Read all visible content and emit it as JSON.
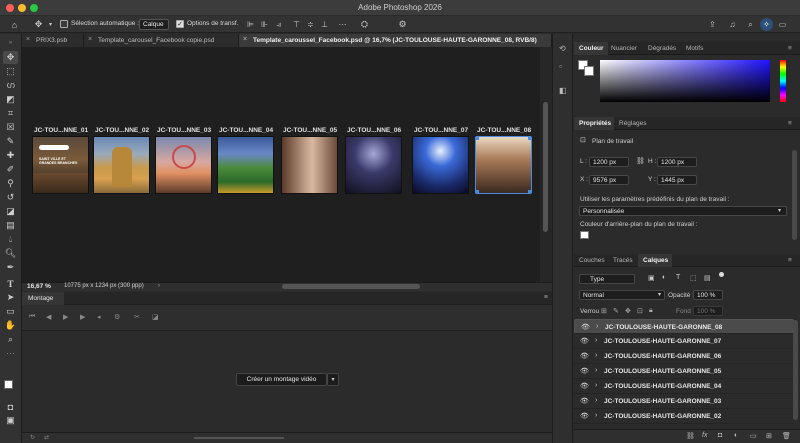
{
  "app": {
    "title": "Adobe Photoshop 2026"
  },
  "options_bar": {
    "auto_select_label": "Sélection automatique :",
    "auto_select_value": "Calque",
    "transform_options_label": "Options de transf."
  },
  "tabs": [
    {
      "label": "PRIX3.psb"
    },
    {
      "label": "Template_carousel_Facebook copie.psd"
    },
    {
      "label": "Template_caroussel_Facebook.psd @ 16,7% (JC-TOULOUSE-HAUTE-GARONNE_08, RVB/8)"
    }
  ],
  "artboards": [
    {
      "label": "JC-TOU...NNE_01",
      "overlay": "SAINT VILLE ET\nGRANDES BRANCHES"
    },
    {
      "label": "JC-TOU...NNE_02"
    },
    {
      "label": "JC-TOU...NNE_03"
    },
    {
      "label": "JC-TOU...NNE_04"
    },
    {
      "label": "JC-TOU...NNE_05"
    },
    {
      "label": "JC-TOU...NNE_06"
    },
    {
      "label": "JC-TOU...NNE_07"
    },
    {
      "label": "JC-TOU...NNE_08"
    }
  ],
  "status": {
    "zoom": "16,67 %",
    "doc_size": "10775 px x 1234 px (300 ppp)"
  },
  "montage": {
    "tab": "Montage",
    "create_button": "Créer un montage vidéo"
  },
  "color_panel": {
    "tabs": [
      "Couleur",
      "Nuancier",
      "Dégradés",
      "Motifs"
    ]
  },
  "properties_panel": {
    "tabs": [
      "Propriétés",
      "Réglages"
    ],
    "section": "Plan de travail",
    "w_label": "L :",
    "w_value": "1200 px",
    "h_label": "H :",
    "h_value": "1200 px",
    "x_label": "X :",
    "x_value": "9576 px",
    "y_label": "Y :",
    "y_value": "1445 px",
    "preset_label": "Utiliser les paramètres prédéfinis du plan de travail :",
    "preset_value": "Personnalisée",
    "bg_label": "Couleur d'arrière-plan du plan de travail :"
  },
  "layers_panel": {
    "tabs": [
      "Couches",
      "Tracés",
      "Calques"
    ],
    "filter_value": "Type",
    "blend_mode": "Normal",
    "opacity_label": "Opacité :",
    "opacity_value": "100 %",
    "lock_label": "Verrou :",
    "fill_label": "Fond :",
    "fill_value": "100 %",
    "layers": [
      {
        "name": "JC-TOULOUSE-HAUTE-GARONNE_08",
        "selected": true
      },
      {
        "name": "JC-TOULOUSE-HAUTE-GARONNE_07"
      },
      {
        "name": "JC-TOULOUSE-HAUTE-GARONNE_06"
      },
      {
        "name": "JC-TOULOUSE-HAUTE-GARONNE_05"
      },
      {
        "name": "JC-TOULOUSE-HAUTE-GARONNE_04"
      },
      {
        "name": "JC-TOULOUSE-HAUTE-GARONNE_03"
      },
      {
        "name": "JC-TOULOUSE-HAUTE-GARONNE_02"
      }
    ]
  },
  "colors": {
    "accent": "#4a8de0",
    "hue_selected": "#1f12ff"
  }
}
